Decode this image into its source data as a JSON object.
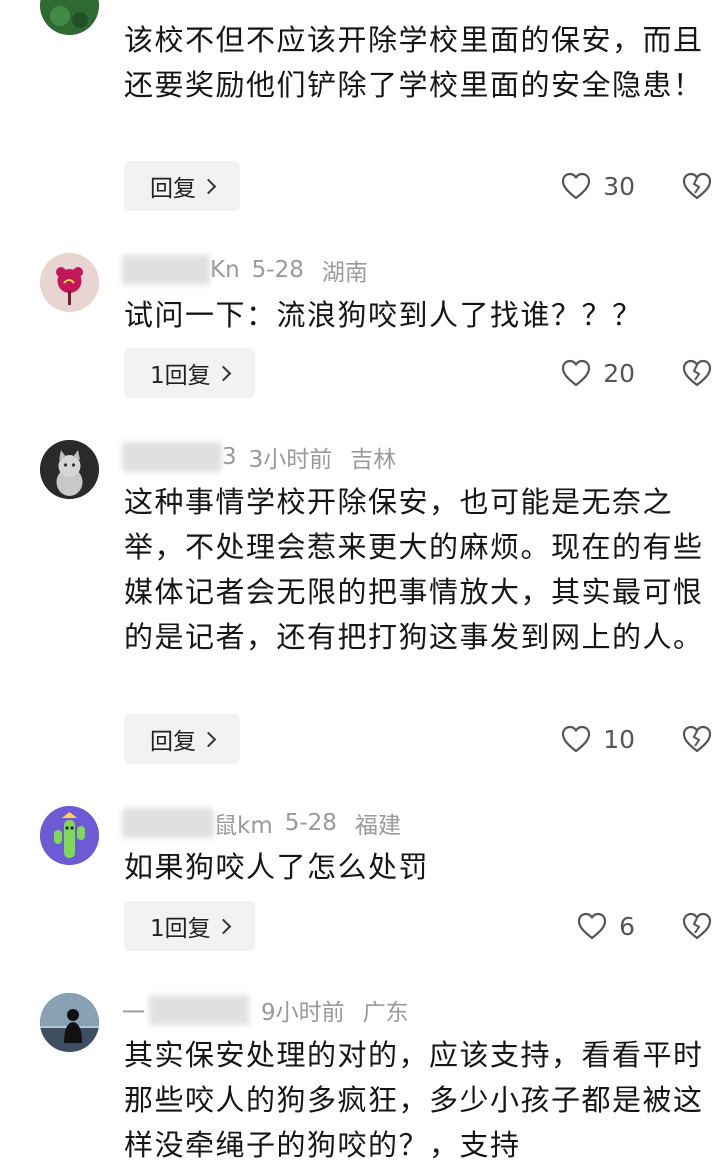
{
  "comments": [
    {
      "text": "该校不但不应该开除学校里面的保安，而且还要奖励他们铲除了学校里面的安全隐患！",
      "reply_label": "回复",
      "likes": "30"
    },
    {
      "name_visible": "Kn",
      "date": "5-28",
      "region": "湖南",
      "text": "试问一下：流浪狗咬到人了找谁？？？",
      "reply_label": "1回复",
      "likes": "20"
    },
    {
      "name_visible": "3",
      "date": "3小时前",
      "region": "吉林",
      "text": "这种事情学校开除保安，也可能是无奈之举，不处理会惹来更大的麻烦。现在的有些媒体记者会无限的把事情放大，其实最可恨的是记者，还有把打狗这事发到网上的人。",
      "reply_label": "回复",
      "likes": "10"
    },
    {
      "name_visible": "鼠km",
      "date": "5-28",
      "region": "福建",
      "text": "如果狗咬人了怎么处罚",
      "reply_label": "1回复",
      "likes": "6"
    },
    {
      "name_visible": "一",
      "date": "9小时前",
      "region": "广东",
      "text": "其实保安处理的对的，应该支持，看看平时那些咬人的狗多疯狂，多少小孩子都是被这样没牵绳子的狗咬的？，支持",
      "likes": ""
    }
  ]
}
